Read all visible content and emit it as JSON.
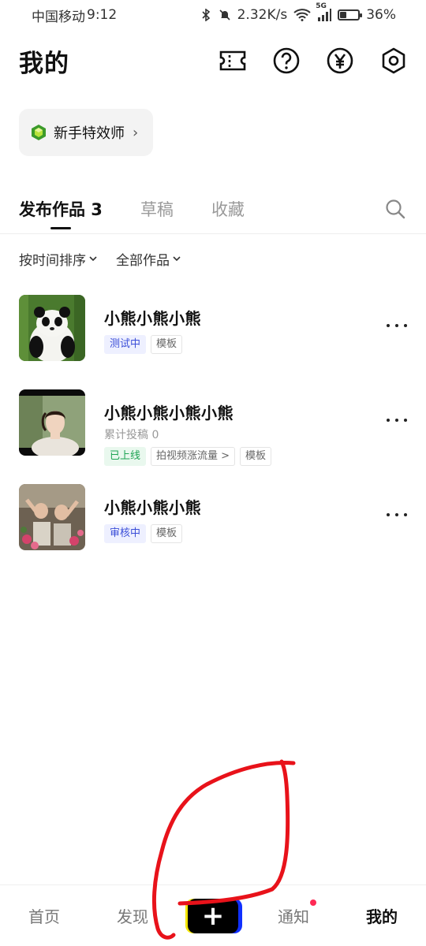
{
  "status_bar": {
    "carrier": "中国移动",
    "time": "9:12",
    "speed": "2.32K/s",
    "network": "5G",
    "battery": "36%",
    "battery_level": 0.36
  },
  "header": {
    "title": "我的",
    "icons": [
      "ticket-icon",
      "help-icon",
      "yuan-icon",
      "settings-icon"
    ]
  },
  "badge": {
    "label": "新手特效师",
    "icon": "gem-icon"
  },
  "tabs": [
    {
      "label": "发布作品 3",
      "active": true
    },
    {
      "label": "草稿",
      "active": false
    },
    {
      "label": "收藏",
      "active": false
    }
  ],
  "filters": {
    "sort": "按时间排序",
    "scope": "全部作品"
  },
  "works": [
    {
      "title": "小熊小熊小熊",
      "tags": [
        {
          "text": "测试中",
          "style": "blue"
        },
        {
          "text": "模板",
          "style": "plain"
        }
      ]
    },
    {
      "title": "小熊小熊小熊小熊",
      "subtitle": "累计投稿 0",
      "tags": [
        {
          "text": "已上线",
          "style": "green"
        },
        {
          "text": "拍视频涨流量 >",
          "style": "plain"
        },
        {
          "text": "模板",
          "style": "plain"
        }
      ]
    },
    {
      "title": "小熊小熊小熊",
      "tags": [
        {
          "text": "审核中",
          "style": "blue"
        },
        {
          "text": "模板",
          "style": "plain"
        }
      ]
    }
  ],
  "bottom_nav": {
    "home": "首页",
    "discover": "发现",
    "create": "+",
    "notify": "通知",
    "me": "我的"
  },
  "colors": {
    "accent_blue": "#3c4fd8",
    "accent_green": "#1fa454",
    "dot_red": "#ff2a55",
    "annotation_red": "#e8121a"
  }
}
